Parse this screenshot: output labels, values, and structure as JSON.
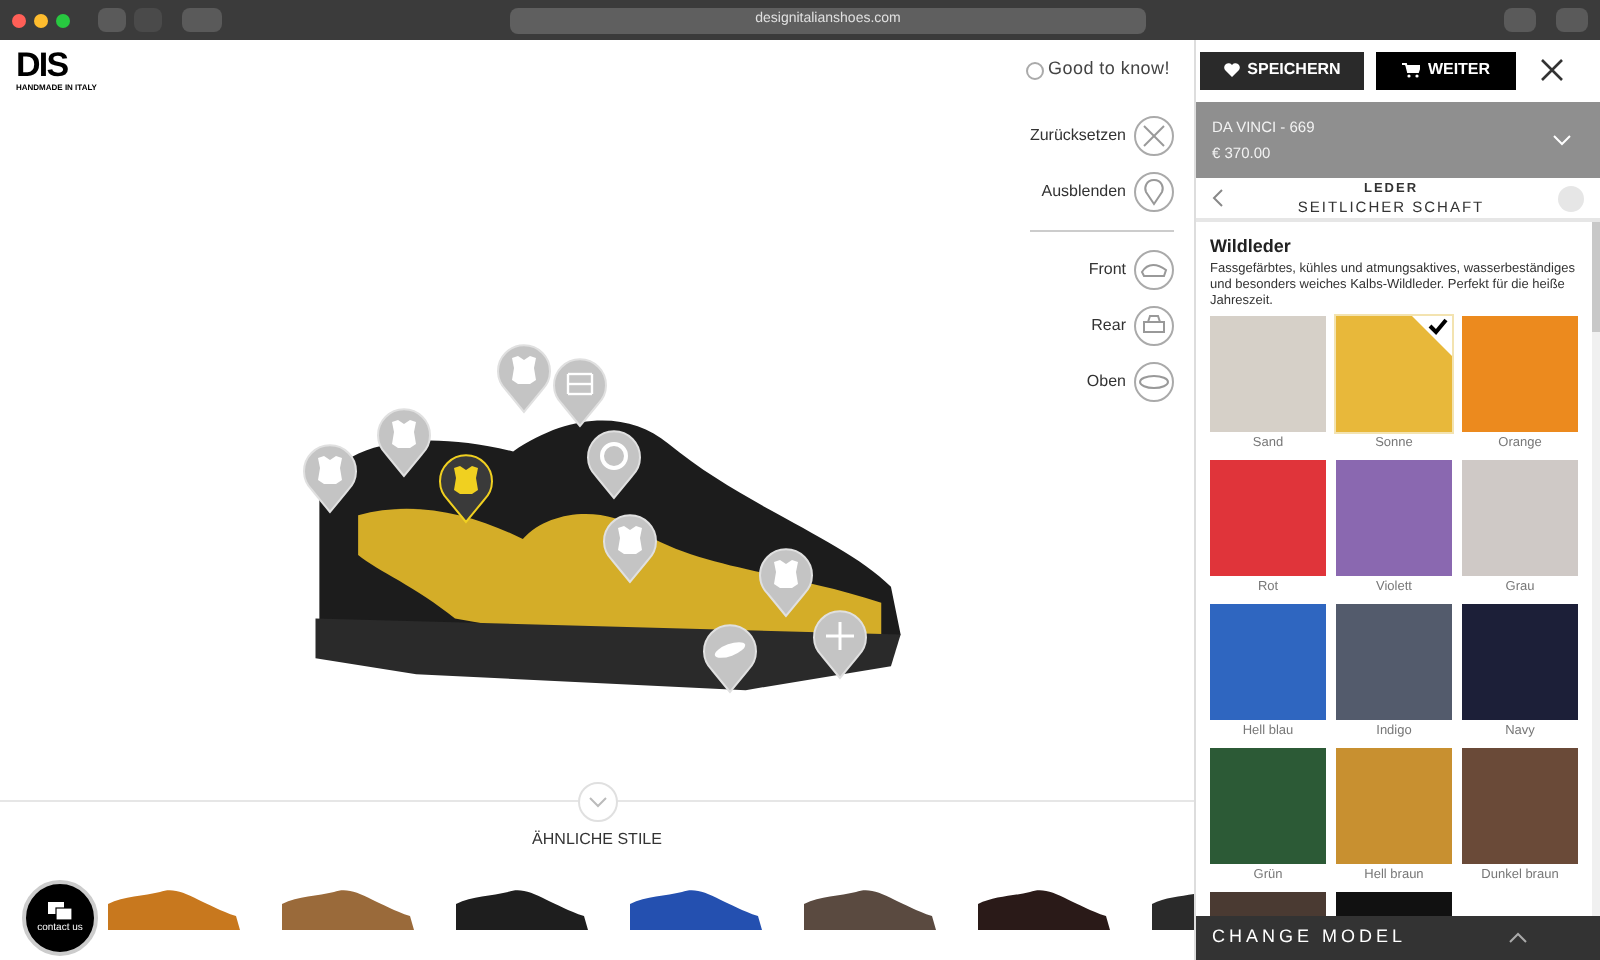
{
  "browser": {
    "url": "designitalianshoes.com"
  },
  "header": {
    "logo": "DIS",
    "tagline": "HANDMADE IN ITALY",
    "info": "Good to know!",
    "save_button": "SPEICHERN",
    "next_button": "WEITER"
  },
  "view_controls": [
    {
      "label": "Zurücksetzen",
      "kind": "reset"
    },
    {
      "label": "Ausblenden",
      "kind": "hide"
    },
    {
      "label": "Front",
      "kind": "front"
    },
    {
      "label": "Rear",
      "kind": "rear"
    },
    {
      "label": "Oben",
      "kind": "top"
    }
  ],
  "pins": [
    {
      "kind": "leather",
      "selected": false
    },
    {
      "kind": "leather",
      "selected": false
    },
    {
      "kind": "leather",
      "selected": true
    },
    {
      "kind": "leather",
      "selected": false
    },
    {
      "kind": "laces",
      "selected": false
    },
    {
      "kind": "ring",
      "selected": false
    },
    {
      "kind": "leather",
      "selected": false
    },
    {
      "kind": "leather",
      "selected": false
    },
    {
      "kind": "sole",
      "selected": false
    },
    {
      "kind": "plus",
      "selected": false
    }
  ],
  "similar": {
    "title": "ÄHNLICHE STILE",
    "shoes": [
      {
        "color": "#c8781e"
      },
      {
        "color": "#9a6a3a"
      },
      {
        "color": "#1e1e1e"
      },
      {
        "color": "#2450b0"
      },
      {
        "color": "#5a4a40"
      },
      {
        "color": "#2a1a18"
      },
      {
        "color": "#2a2a2a"
      }
    ]
  },
  "contact": {
    "label": "contact us"
  },
  "panel": {
    "model": "DA VINCI - 669",
    "price": "€ 370.00",
    "category": "LEDER",
    "part": "SEITLICHER SCHAFT",
    "material": "Wildleder",
    "description": "Fassgefärbtes, kühles und atmungsaktives, wasserbeständiges und besonders weiches Kalbs-Wildleder. Perfekt für die heiße Jahreszeit.",
    "swatches": [
      {
        "name": "Sand",
        "color": "#d6d0c8",
        "selected": false
      },
      {
        "name": "Sonne",
        "color": "#e8b83a",
        "selected": true
      },
      {
        "name": "Orange",
        "color": "#ec8a1e",
        "selected": false
      },
      {
        "name": "Rot",
        "color": "#e0343a",
        "selected": false
      },
      {
        "name": "Violett",
        "color": "#8a68b0",
        "selected": false
      },
      {
        "name": "Grau",
        "color": "#cfc9c6",
        "selected": false
      },
      {
        "name": "Hell blau",
        "color": "#2f66c0",
        "selected": false
      },
      {
        "name": "Indigo",
        "color": "#535b6c",
        "selected": false
      },
      {
        "name": "Navy",
        "color": "#1c1f38",
        "selected": false
      },
      {
        "name": "Grün",
        "color": "#2c5a36",
        "selected": false
      },
      {
        "name": "Hell braun",
        "color": "#c89030",
        "selected": false
      },
      {
        "name": "Dunkel braun",
        "color": "#6a4a38",
        "selected": false
      },
      {
        "color": "#4a3a32",
        "selected": false
      },
      {
        "color": "#111111",
        "selected": false
      }
    ],
    "change_model": "CHANGE MODEL"
  }
}
